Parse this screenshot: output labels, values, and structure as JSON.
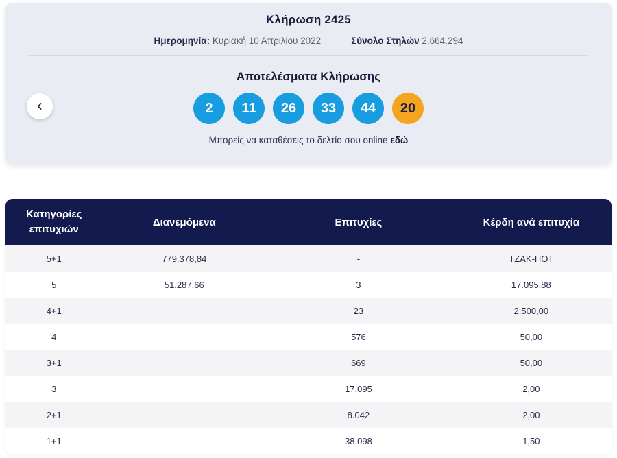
{
  "header": {
    "title": "Κλήρωση 2425",
    "date_label": "Ημερομηνία:",
    "date_value": "Κυριακή 10 Απριλίου 2022",
    "columns_label": "Σύνολο Στηλών",
    "columns_value": "2.664.294"
  },
  "results": {
    "title": "Αποτελέσματα Κλήρωσης",
    "numbers": [
      "2",
      "11",
      "26",
      "33",
      "44"
    ],
    "bonus": "20",
    "deposit_text": "Μπορείς να καταθέσεις το δελτίο σου online",
    "deposit_link": "εδώ"
  },
  "nav": {
    "prev_icon": "chevron-left-icon"
  },
  "table": {
    "headers": [
      "Κατηγορίες επιτυχιών",
      "Διανεμόμενα",
      "Επιτυχίες",
      "Κέρδη ανά επιτυχία"
    ],
    "rows": [
      {
        "category": "5+1",
        "distributed": "779.378,84",
        "winners": "-",
        "prize": "ΤΖΑΚ-ΠΟΤ"
      },
      {
        "category": "5",
        "distributed": "51.287,66",
        "winners": "3",
        "prize": "17.095,88"
      },
      {
        "category": "4+1",
        "distributed": "",
        "winners": "23",
        "prize": "2.500,00"
      },
      {
        "category": "4",
        "distributed": "",
        "winners": "576",
        "prize": "50,00"
      },
      {
        "category": "3+1",
        "distributed": "",
        "winners": "669",
        "prize": "50,00"
      },
      {
        "category": "3",
        "distributed": "",
        "winners": "17.095",
        "prize": "2,00"
      },
      {
        "category": "2+1",
        "distributed": "",
        "winners": "8.042",
        "prize": "2,00"
      },
      {
        "category": "1+1",
        "distributed": "",
        "winners": "38.098",
        "prize": "1,50"
      }
    ]
  },
  "colors": {
    "navy": "#131b4e",
    "main_ball": "#179de0",
    "bonus_ball": "#f5a41f",
    "card_background": "#eaecf3",
    "row_alt": "#f4f4f7"
  }
}
